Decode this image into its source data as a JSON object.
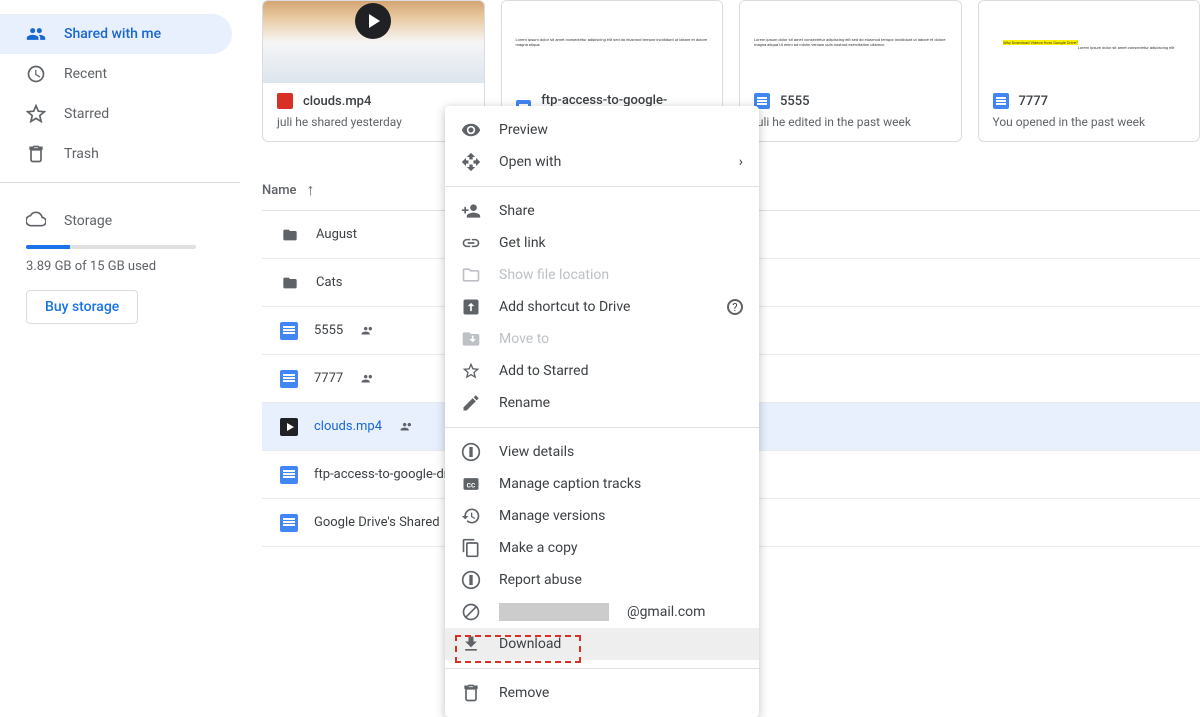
{
  "sidebar": {
    "items": [
      {
        "label": "Shared with me",
        "icon": "people"
      },
      {
        "label": "Recent",
        "icon": "clock"
      },
      {
        "label": "Starred",
        "icon": "star"
      },
      {
        "label": "Trash",
        "icon": "trash"
      }
    ],
    "storage_label": "Storage",
    "storage_text": "3.89 GB of 15 GB used",
    "buy_label": "Buy storage"
  },
  "cards": [
    {
      "title": "clouds.mp4",
      "subtitle": "juli he shared yesterday",
      "type": "video"
    },
    {
      "title": "ftp-access-to-google-drive-...",
      "subtitle": "",
      "type": "doc"
    },
    {
      "title": "5555",
      "subtitle": "juli he edited in the past week",
      "type": "doc"
    },
    {
      "title": "7777",
      "subtitle": "You opened in the past week",
      "type": "doc"
    }
  ],
  "list_header": {
    "name": "Name"
  },
  "files": [
    {
      "name": "August",
      "type": "folder",
      "shared": false
    },
    {
      "name": "Cats",
      "type": "folder",
      "shared": false
    },
    {
      "name": "5555",
      "type": "doc",
      "shared": true
    },
    {
      "name": "7777",
      "type": "doc",
      "shared": true
    },
    {
      "name": "clouds.mp4",
      "type": "video",
      "shared": true,
      "selected": true
    },
    {
      "name": "ftp-access-to-google-drive",
      "type": "doc",
      "shared": false
    },
    {
      "name": "Google Drive's Shared",
      "type": "doc",
      "shared": false
    }
  ],
  "context_menu": {
    "preview": "Preview",
    "open_with": "Open with",
    "share": "Share",
    "get_link": "Get link",
    "show_location": "Show file location",
    "add_shortcut": "Add shortcut to Drive",
    "move_to": "Move to",
    "add_starred": "Add to Starred",
    "rename": "Rename",
    "view_details": "View details",
    "caption": "Manage caption tracks",
    "versions": "Manage versions",
    "make_copy": "Make a copy",
    "report": "Report abuse",
    "email_suffix": "@gmail.com",
    "download": "Download",
    "remove": "Remove"
  }
}
